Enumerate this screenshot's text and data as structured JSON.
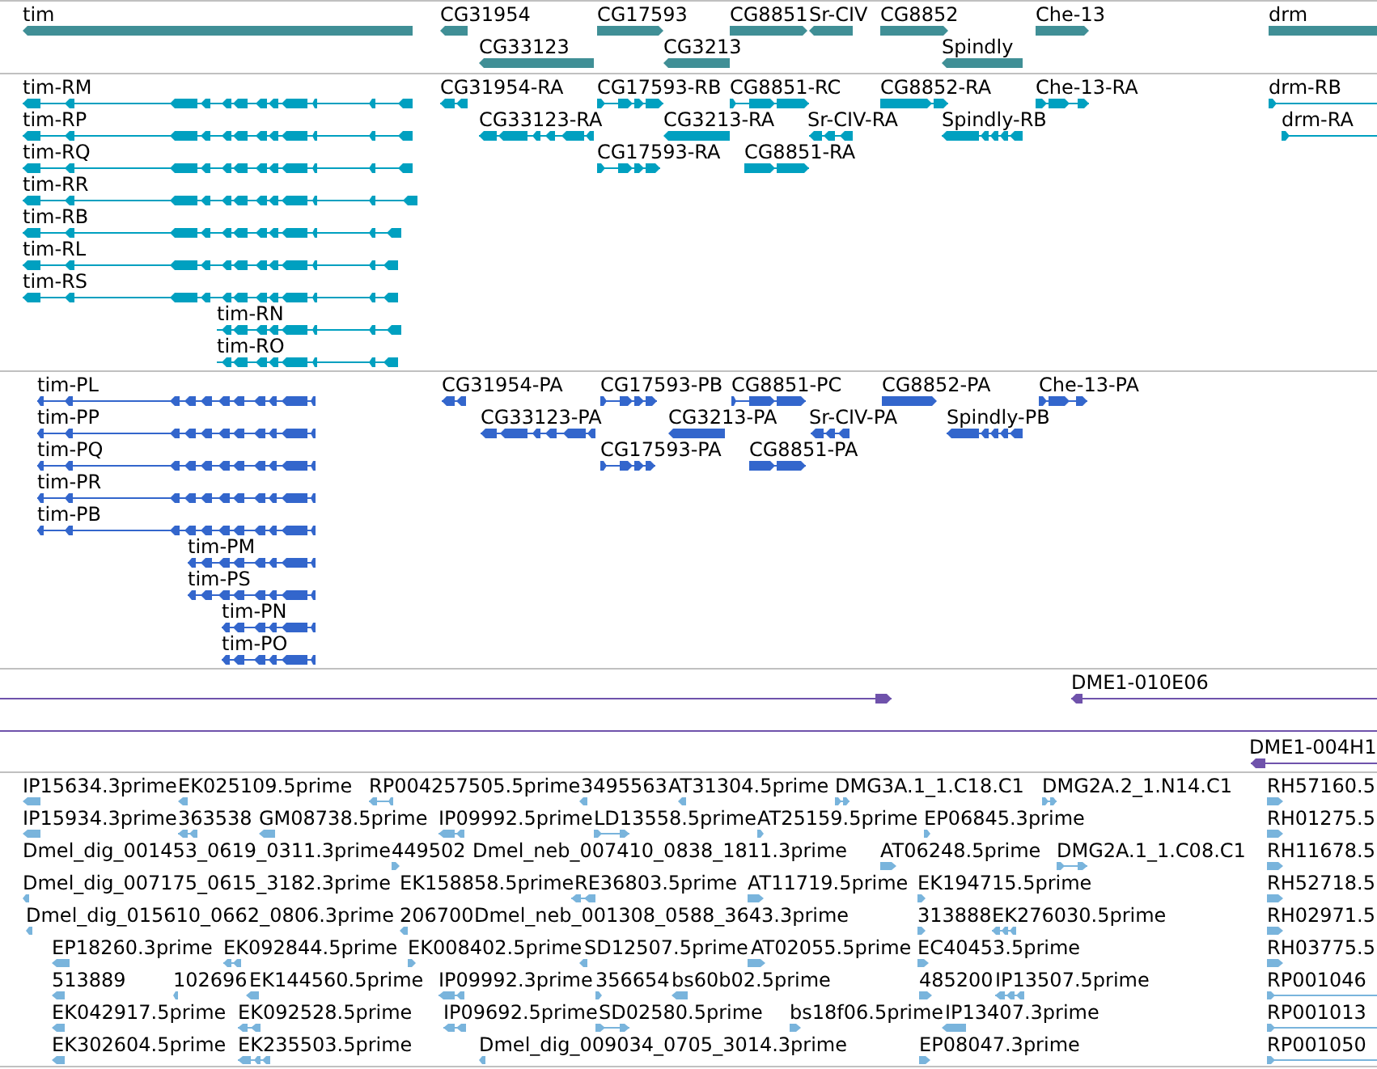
{
  "tracks": [
    {
      "kind": "gene",
      "color": "#408f96",
      "features": [
        {
          "label": "tim",
          "reverse": true
        },
        {
          "label": "CG31954",
          "reverse": true
        },
        {
          "label": "CG17593",
          "reverse": false
        },
        {
          "label": "CG8851",
          "reverse": false
        },
        {
          "label": "Sr-CIV",
          "reverse": true
        },
        {
          "label": "CG8852",
          "reverse": false
        },
        {
          "label": "Che-13",
          "reverse": false
        },
        {
          "label": "drm",
          "reverse": false
        },
        {
          "label": "CG33123",
          "reverse": true
        },
        {
          "label": "CG3213",
          "reverse": true
        },
        {
          "label": "Spindly",
          "reverse": true
        }
      ]
    },
    {
      "kind": "transcript",
      "color": "#00a0c0",
      "features": [
        {
          "label": "tim-RM",
          "reverse": true
        },
        {
          "label": "CG31954-RA",
          "reverse": true
        },
        {
          "label": "CG17593-RB",
          "reverse": false
        },
        {
          "label": "CG8851-RC",
          "reverse": false
        },
        {
          "label": "CG8852-RA",
          "reverse": false
        },
        {
          "label": "Che-13-RA",
          "reverse": false
        },
        {
          "label": "drm-RB",
          "reverse": false
        },
        {
          "label": "tim-RP",
          "reverse": true
        },
        {
          "label": "CG33123-RA",
          "reverse": true
        },
        {
          "label": "CG3213-RA",
          "reverse": true
        },
        {
          "label": "Sr-CIV-RA",
          "reverse": true
        },
        {
          "label": "Spindly-RB",
          "reverse": true
        },
        {
          "label": "drm-RA",
          "reverse": false
        },
        {
          "label": "tim-RQ",
          "reverse": true
        },
        {
          "label": "CG17593-RA",
          "reverse": false
        },
        {
          "label": "CG8851-RA",
          "reverse": false
        },
        {
          "label": "tim-RR",
          "reverse": true
        },
        {
          "label": "tim-RB",
          "reverse": true
        },
        {
          "label": "tim-RL",
          "reverse": true
        },
        {
          "label": "tim-RS",
          "reverse": true
        },
        {
          "label": "tim-RN",
          "reverse": true
        },
        {
          "label": "tim-RO",
          "reverse": true
        }
      ]
    },
    {
      "kind": "cds",
      "color": "#3366cc",
      "features": [
        {
          "label": "tim-PL",
          "reverse": true
        },
        {
          "label": "CG31954-PA",
          "reverse": true
        },
        {
          "label": "CG17593-PB",
          "reverse": false
        },
        {
          "label": "CG8851-PC",
          "reverse": false
        },
        {
          "label": "CG8852-PA",
          "reverse": false
        },
        {
          "label": "Che-13-PA",
          "reverse": false
        },
        {
          "label": "tim-PP",
          "reverse": true
        },
        {
          "label": "CG33123-PA",
          "reverse": true
        },
        {
          "label": "CG3213-PA",
          "reverse": true
        },
        {
          "label": "Sr-CIV-PA",
          "reverse": true
        },
        {
          "label": "Spindly-PB",
          "reverse": true
        },
        {
          "label": "tim-PQ",
          "reverse": true
        },
        {
          "label": "CG17593-PA",
          "reverse": false
        },
        {
          "label": "CG8851-PA",
          "reverse": false
        },
        {
          "label": "tim-PR",
          "reverse": true
        },
        {
          "label": "tim-PB",
          "reverse": true
        },
        {
          "label": "tim-PM",
          "reverse": true
        },
        {
          "label": "tim-PS",
          "reverse": true
        },
        {
          "label": "tim-PN",
          "reverse": true
        },
        {
          "label": "tim-PO",
          "reverse": true
        }
      ]
    },
    {
      "kind": "clone",
      "color": "#6f52ab",
      "features": [
        {
          "kind": "arrow",
          "reverse": false
        },
        {
          "kind": "arrow",
          "label": "DME1-010E06",
          "reverse": true
        },
        {
          "kind": "line"
        },
        {
          "kind": "arrow",
          "label": "DME1-004H1",
          "reverse": true
        }
      ]
    },
    {
      "kind": "est",
      "color": "#79b4dc",
      "features": [
        {
          "label": "IP15634.3prime",
          "reverse": true
        },
        {
          "label": "EK025109.5prime",
          "reverse": true
        },
        {
          "label": "RP004257505.5prime",
          "reverse": true
        },
        {
          "label": "3495563",
          "reverse": true
        },
        {
          "label": "AT31304.5prime",
          "reverse": true
        },
        {
          "label": "DMG3A.1_1.C18.C1",
          "reverse": false
        },
        {
          "label": "DMG2A.2_1.N14.C1",
          "reverse": false
        },
        {
          "label": "RH57160.5",
          "reverse": false
        },
        {
          "label": "IP15934.3prime",
          "reverse": true
        },
        {
          "label": "363538",
          "reverse": true
        },
        {
          "label": "GM08738.5prime",
          "reverse": true
        },
        {
          "label": "IP09992.5prime",
          "reverse": true
        },
        {
          "label": "LD13558.5prime",
          "reverse": false
        },
        {
          "label": "AT25159.5prime",
          "reverse": false
        },
        {
          "label": "EP06845.3prime",
          "reverse": false
        },
        {
          "label": "RH01275.5",
          "reverse": false
        },
        {
          "label": "Dmel_dig_001453_0619_0311.3prime"
        },
        {
          "label": "449502",
          "reverse": false
        },
        {
          "label": "Dmel_neb_007410_0838_1811.3prime"
        },
        {
          "label": "AT06248.5prime",
          "reverse": false
        },
        {
          "label": "DMG2A.1_1.C08.C1",
          "reverse": false
        },
        {
          "label": "RH11678.5",
          "reverse": false
        },
        {
          "label": "Dmel_dig_007175_0615_3182.3prime",
          "reverse": true
        },
        {
          "label": "EK158858.5prime"
        },
        {
          "label": "RE36803.5prime",
          "reverse": true
        },
        {
          "label": "AT11719.5prime",
          "reverse": false
        },
        {
          "label": "EK194715.5prime",
          "reverse": false
        },
        {
          "label": "RH52718.5",
          "reverse": false
        },
        {
          "label": "Dmel_dig_015610_0662_0806.3prime",
          "reverse": true
        },
        {
          "label": "206700",
          "reverse": true
        },
        {
          "label": "Dmel_neb_001308_0588_3643.3prime"
        },
        {
          "label": "313888",
          "reverse": false
        },
        {
          "label": "EK276030.5prime",
          "reverse": true
        },
        {
          "label": "RH02971.5",
          "reverse": false
        },
        {
          "label": "EP18260.3prime",
          "reverse": true
        },
        {
          "label": "EK092844.5prime",
          "reverse": true
        },
        {
          "label": "EK008402.5prime",
          "reverse": false
        },
        {
          "label": "SD12507.5prime",
          "reverse": true
        },
        {
          "label": "AT02055.5prime",
          "reverse": false
        },
        {
          "label": "EC40453.5prime",
          "reverse": false
        },
        {
          "label": "RH03775.5",
          "reverse": false
        },
        {
          "label": "513889",
          "reverse": true
        },
        {
          "label": "102696",
          "reverse": true
        },
        {
          "label": "EK144560.5prime",
          "reverse": true
        },
        {
          "label": "IP09992.3prime",
          "reverse": true
        },
        {
          "label": "356654",
          "reverse": false
        },
        {
          "label": "bs60b02.5prime",
          "reverse": true
        },
        {
          "label": "485200",
          "reverse": false
        },
        {
          "label": "IP13507.5prime",
          "reverse": true
        },
        {
          "label": "RP001046",
          "reverse": false
        },
        {
          "label": "EK042917.5prime",
          "reverse": true
        },
        {
          "label": "EK092528.5prime",
          "reverse": true
        },
        {
          "label": "IP09692.5prime",
          "reverse": true
        },
        {
          "label": "SD02580.5prime",
          "reverse": false
        },
        {
          "label": "bs18f06.5prime",
          "reverse": false
        },
        {
          "label": "IP13407.3prime",
          "reverse": true
        },
        {
          "label": "RP001013",
          "reverse": false
        },
        {
          "label": "EK302604.5prime",
          "reverse": true
        },
        {
          "label": "EK235503.5prime",
          "reverse": true
        },
        {
          "label": "Dmel_dig_009034_0705_3014.3prime",
          "reverse": true
        },
        {
          "label": "EP08047.3prime",
          "reverse": false
        },
        {
          "label": "RP001050",
          "reverse": false
        }
      ]
    }
  ]
}
